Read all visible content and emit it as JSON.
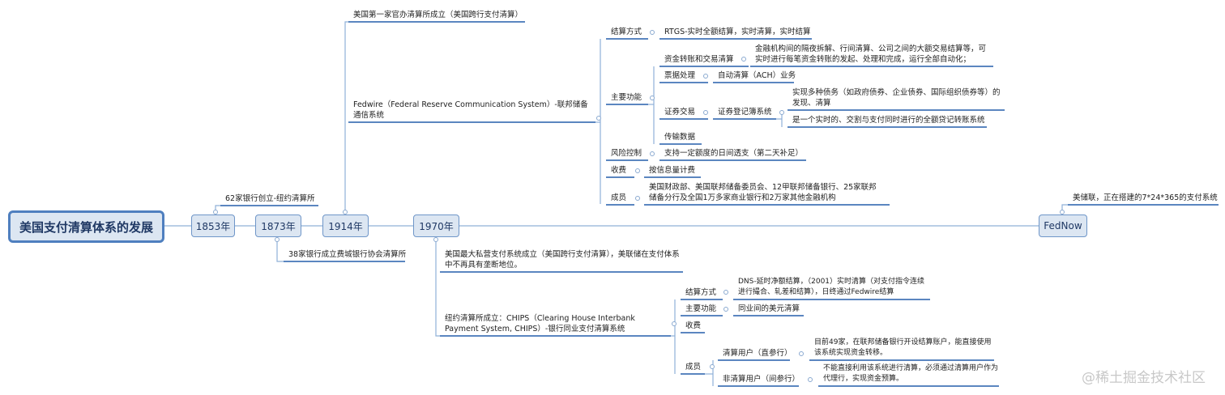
{
  "root": "美国支付清算体系的发展",
  "timeline": {
    "y1853": "1853年",
    "y1873": "1873年",
    "y1914": "1914年",
    "y1970": "1970年",
    "fednow": "FedNow"
  },
  "e1853": "62家银行创立-纽约清算所",
  "e1873": "38家银行成立费城银行协会清算所",
  "e1914": {
    "first": "美国第一家官办清算所成立（美国跨行支付清算）",
    "fedwire": "Fedwire（Federal Reserve Communication System）-联邦储备通信系统",
    "settle": "结算方式",
    "settle_v": "RTGS-实时全额结算，实时清算，实时结算",
    "func": "主要功能",
    "f1": "资金转账和交易清算",
    "f1_v": "金融机构间的隔夜拆解、行间清算、公司之间的大额交易结算等，可实时进行每笔资金转账的发起、处理和完成，运行全部自动化；",
    "f2": "票据处理",
    "f2_v": "自动清算（ACH）业务",
    "f3": "证券交易",
    "f3_v": "证券登记簿系统",
    "f3_a": "实现多种债务（如政府债券、企业债券、国际组织债券等）的发现、清算",
    "f3_b": "是一个实时的、交割与支付同时进行的全额贷记转账系统",
    "f4": "传输数据",
    "risk": "风险控制",
    "risk_v": "支持一定额度的日间透支（第二天补足）",
    "fee": "收费",
    "fee_v": "按信息量计费",
    "member": "成员",
    "member_v": "美国财政部、美国联邦储备委员会、12甲联邦储备银行、25家联邦储备分行及全国1万多家商业银行和2万家其他金融机构"
  },
  "e1970": {
    "private": "美国最大私营支付系统成立（美国跨行支付清算），美联储在支付体系中不再具有垄断地位。",
    "chips": "纽约清算所成立：CHIPS（Clearing House Interbank Payment System, CHIPS）-银行同业支付清算系统",
    "settle": "结算方式",
    "settle_v": "DNS-延时净额结算，（2001）实时清算（对支付指令连续进行撮合、轧差和结算），日终通过Fedwire结算",
    "func": "主要功能",
    "func_v": "同业间的美元清算",
    "fee": "收费",
    "member": "成员",
    "m1": "清算用户（直参行）",
    "m1_v": "目前49家，在联邦储备银行开设结算账户，能直接使用该系统实现资金转移。",
    "m2": "非清算用户（间参行）",
    "m2_v": "不能直接利用该系统进行清算，必须通过清算用户作为代理行，实现资金预算。"
  },
  "fednow": "美储联，正在搭建的7*24*365的支付系统",
  "watermark": "@稀土掘金技术社区",
  "colors": {
    "line": "#5b86c0",
    "box": "#dce6f2"
  }
}
